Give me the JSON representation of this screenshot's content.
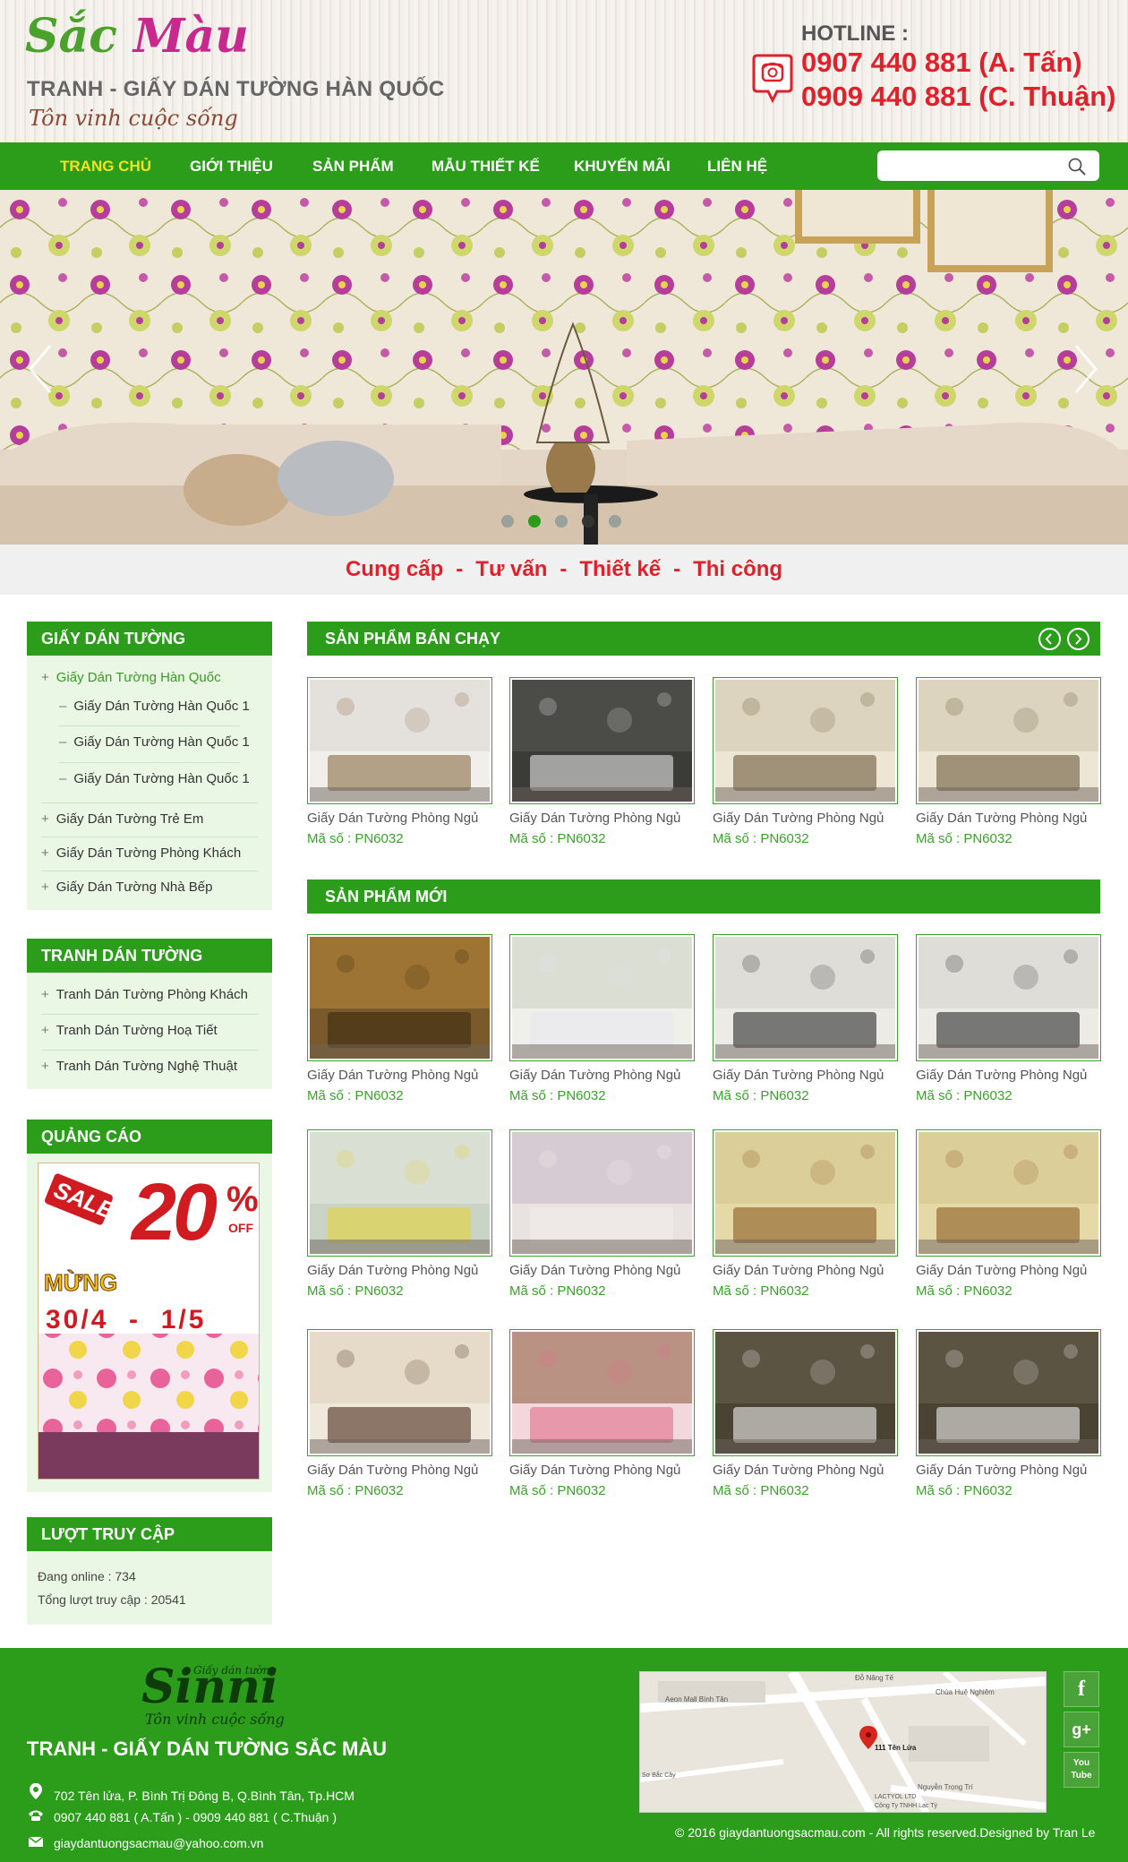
{
  "header": {
    "logo_word1": "Sắc",
    "logo_word2": "Màu",
    "tagline": "TRANH - GIẤY DÁN TƯỜNG HÀN QUỐC",
    "slogan": "Tôn vinh cuộc sống",
    "hotline_label": "HOTLINE :",
    "phone1": "0907 440 881 (A. Tấn)",
    "phone2": "0909 440 881 (C. Thuận)"
  },
  "nav": {
    "items": [
      "TRANG CHỦ",
      "GIỚI THIỆU",
      "SẢN PHẨM",
      "MẪU THIẾT KẾ",
      "KHUYẾN MÃI",
      "LIÊN HỆ"
    ],
    "search_placeholder": ""
  },
  "banner": {
    "dots": 5,
    "active_dot": 2
  },
  "services": [
    "Cung cấp",
    "Tư vấn",
    "Thiết kế",
    "Thi công"
  ],
  "sidebar": {
    "wallpaper": {
      "title": "GIẤY DÁN TƯỜNG",
      "parent": "Giấy Dán Tường Hàn  Quốc",
      "children": [
        "Giấy Dán Tường Hàn Quốc 1",
        "Giấy Dán Tường Hàn Quốc 1",
        "Giấy Dán Tường Hàn Quốc 1"
      ],
      "items": [
        "Giấy Dán Tường Trẻ Em",
        "Giấy Dán Tường Phòng Khách",
        "Giấy Dán Tường Nhà Bếp"
      ]
    },
    "paintings": {
      "title": "TRANH DÁN TƯỜNG",
      "items": [
        "Tranh Dán Tường Phòng Khách",
        "Tranh Dán Tường Hoạ Tiết",
        "Tranh Dán Tường Nghệ Thuật"
      ]
    },
    "ads": {
      "title": "QUẢNG CÁO",
      "sale": "SALE",
      "percent": "20",
      "off": "OFF",
      "greeting": "MỪNG",
      "dates": "30/4  -  1/5"
    },
    "visits": {
      "title": "LƯỢT TRUY CẬP",
      "online": "Đang online : 734",
      "total": "Tổng lượt truy cập : 20541"
    }
  },
  "sections": {
    "best_title": "SẢN PHẨM BÁN CHẠY",
    "new_title": "SẢN PHẨM MỚI"
  },
  "product": {
    "name": "Giấy Dán Tường Phòng Ngủ",
    "code": "Mã số : PN6032"
  },
  "footer": {
    "logo_brand": "Sinni",
    "logo_small": "Giấy dán tường",
    "logo_slogan": "Tôn vinh cuộc sống",
    "title": "TRANH - GIẤY DÁN TƯỜNG SẮC MÀU",
    "address": "702 Tên lửa, P. Bình Trị Đông B, Q.Bình Tân, Tp.HCM",
    "phones": "0907 440 881 ( A.Tấn )  -  0909 440 881 ( C.Thuận )",
    "email": "giaydantuongsacmau@yahoo.com.vn",
    "copyright": "© 2016 giaydantuongsacmau.com - All rights reserved.Designed by Tran Le",
    "map_labels": [
      "Aeon Mall Bình Tân",
      "Chùa Huệ Nghiêm",
      "111 Tên Lửa",
      "Nguyễn Trọng Trí",
      "LACTYOL LTD",
      "Công Ty TNHH Lạc Tỷ",
      "Đỗ Năng Tế",
      "Sơ Bắc Cây"
    ],
    "social": [
      "f",
      "g+",
      "You Tube"
    ]
  }
}
